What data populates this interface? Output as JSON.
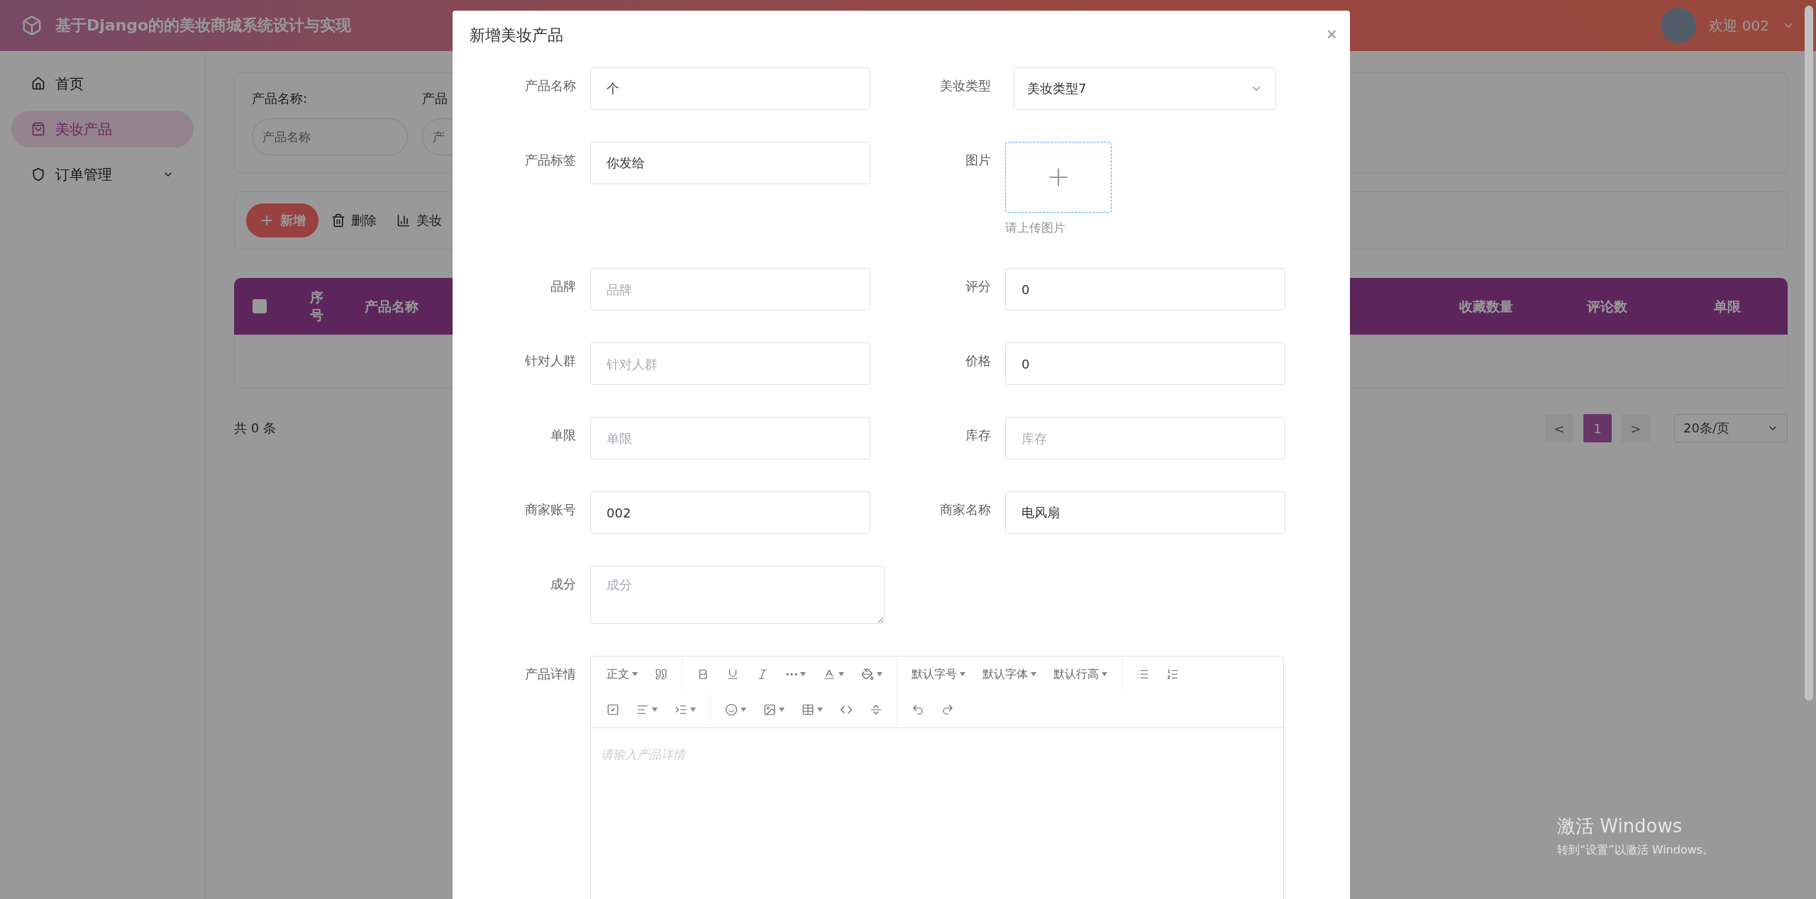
{
  "header": {
    "title": "基于Django的的美妆商城系统设计与实现",
    "user": "欢迎 002"
  },
  "sidebar": {
    "items": [
      {
        "label": "首页",
        "selected": false,
        "expandable": false
      },
      {
        "label": "美妆产品",
        "selected": true,
        "expandable": false
      },
      {
        "label": "订单管理",
        "selected": false,
        "expandable": true
      }
    ]
  },
  "search": {
    "fields": [
      {
        "label": "产品名称:",
        "placeholder": "产品名称"
      },
      {
        "label": "产品",
        "placeholder": "产"
      }
    ]
  },
  "actions": [
    {
      "label": "新增",
      "kind": "primary"
    },
    {
      "label": "删除",
      "kind": "delete"
    },
    {
      "label": "美妆",
      "kind": "chart"
    }
  ],
  "table": {
    "columns": [
      {
        "label": "序号"
      },
      {
        "label": "产品名称"
      },
      {
        "label": "收藏数量"
      },
      {
        "label": "评论数"
      },
      {
        "label": "单限"
      }
    ],
    "all_checked": false
  },
  "pagination": {
    "total": "共 0 条",
    "prev": "<",
    "pages": [
      {
        "label": "1",
        "selected": true
      }
    ],
    "next": ">",
    "page_size": "20条/页"
  },
  "dialog": {
    "title": "新增美妆产品",
    "close": "×",
    "rows": [
      {
        "left": {
          "label": "产品名称",
          "kind": "input",
          "value": "个"
        },
        "right": {
          "label": "美妆类型",
          "kind": "select",
          "value": "美妆类型7"
        }
      },
      {
        "left": {
          "label": "产品标签",
          "kind": "input",
          "value": "你发给"
        },
        "right": {
          "label": "图片",
          "kind": "upload",
          "hint": "请上传图片"
        }
      },
      {
        "left": {
          "label": "品牌",
          "kind": "input",
          "placeholder": "品牌"
        },
        "right": {
          "label": "评分",
          "kind": "input",
          "value": "0"
        }
      },
      {
        "left": {
          "label": "针对人群",
          "kind": "input",
          "placeholder": "针对人群"
        },
        "right": {
          "label": "价格",
          "kind": "input",
          "value": "0"
        }
      },
      {
        "left": {
          "label": "单限",
          "kind": "input",
          "placeholder": "单限"
        },
        "right": {
          "label": "库存",
          "kind": "input",
          "placeholder": "库存"
        }
      },
      {
        "left": {
          "label": "商家账号",
          "kind": "input",
          "value": "002"
        },
        "right": {
          "label": "商家名称",
          "kind": "input",
          "value": "电风扇"
        }
      },
      {
        "left": {
          "label": "成分",
          "kind": "textarea",
          "placeholder": "成分"
        }
      },
      {
        "left": {
          "label": "产品详情",
          "kind": "editor",
          "placeholder": "请输入产品详情",
          "toolbar": [
            "正文",
            "默认字号",
            "默认字体",
            "默认行高"
          ]
        }
      }
    ]
  },
  "activation": {
    "title": "激活 Windows",
    "hint": "转到“设置”以激活 Windows。"
  }
}
